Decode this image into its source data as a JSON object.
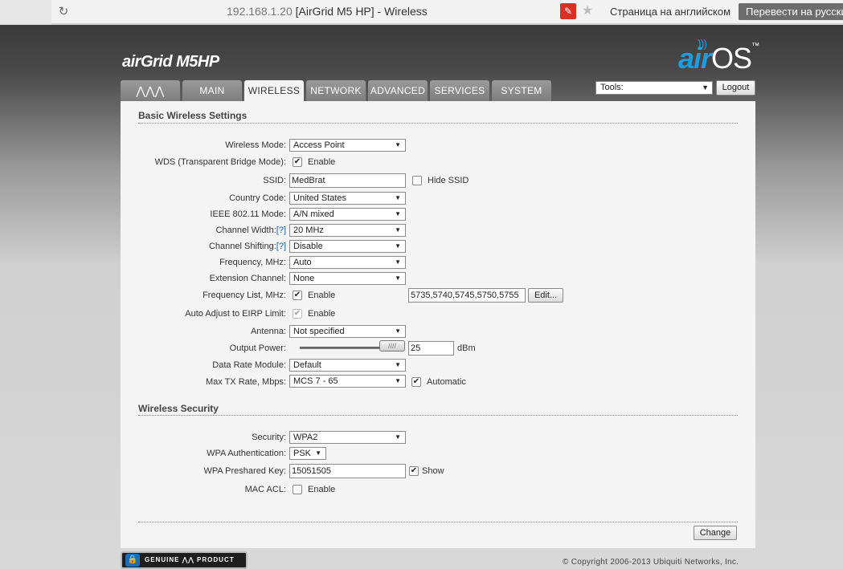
{
  "browser": {
    "url_host": "192.168.1.20",
    "page_title": "[AirGrid M5 HP] - Wireless",
    "translate_prompt": "Страница на английском",
    "translate_button": "Перевести на русский"
  },
  "brand": {
    "product": "airGrid M5HP",
    "os_logo_air": "air",
    "os_logo_os": "OS",
    "os_logo_tm": "™"
  },
  "tabs": [
    {
      "label": "",
      "icon": "ubiquiti-logo-icon"
    },
    {
      "label": "MAIN"
    },
    {
      "label": "WIRELESS",
      "active": true
    },
    {
      "label": "NETWORK"
    },
    {
      "label": "ADVANCED"
    },
    {
      "label": "SERVICES"
    },
    {
      "label": "SYSTEM"
    }
  ],
  "tools": {
    "label": "Tools:",
    "logout": "Logout"
  },
  "basic": {
    "title": "Basic Wireless Settings",
    "wireless_mode": {
      "label": "Wireless Mode:",
      "value": "Access Point"
    },
    "wds": {
      "label": "WDS (Transparent Bridge Mode):",
      "checked": true,
      "option": "Enable"
    },
    "ssid": {
      "label": "SSID:",
      "value": "MedBrat",
      "hide_label": "Hide SSID",
      "hide_checked": false
    },
    "country": {
      "label": "Country Code:",
      "value": "United States"
    },
    "ieee": {
      "label": "IEEE 802.11 Mode:",
      "value": "A/N mixed"
    },
    "channel_width": {
      "label": "Channel Width:",
      "help": "[?]",
      "value": "20 MHz"
    },
    "channel_shifting": {
      "label": "Channel Shifting:",
      "help": "[?]",
      "value": "Disable"
    },
    "frequency": {
      "label": "Frequency, MHz:",
      "value": "Auto"
    },
    "extension": {
      "label": "Extension Channel:",
      "value": "None"
    },
    "freq_list": {
      "label": "Frequency List, MHz:",
      "checked": true,
      "option": "Enable",
      "value": "5735,5740,5745,5750,5755",
      "edit": "Edit..."
    },
    "auto_adjust": {
      "label": "Auto Adjust to EIRP Limit:",
      "checked": true,
      "option": "Enable"
    },
    "antenna": {
      "label": "Antenna:",
      "value": "Not specified"
    },
    "output_power": {
      "label": "Output Power:",
      "value": "25",
      "unit": "dBm",
      "level": 1.0
    },
    "data_rate": {
      "label": "Data Rate Module:",
      "value": "Default"
    },
    "max_tx": {
      "label": "Max TX Rate, Mbps:",
      "value": "MCS 7 - 65",
      "auto_label": "Automatic",
      "auto_checked": true
    }
  },
  "security": {
    "title": "Wireless Security",
    "security": {
      "label": "Security:",
      "value": "WPA2"
    },
    "wpa_auth": {
      "label": "WPA Authentication:",
      "value": "PSK"
    },
    "psk": {
      "label": "WPA Preshared Key:",
      "value": "15051505",
      "show_label": "Show",
      "show_checked": true
    },
    "mac_acl": {
      "label": "MAC ACL:",
      "option": "Enable",
      "checked": false
    }
  },
  "change_button": "Change",
  "footer": {
    "genuine": "GENUINE",
    "product": "PRODUCT",
    "copyright": "© Copyright 2006-2013 Ubiquiti Networks, Inc."
  },
  "icons": {
    "check": "✔",
    "arrow": "▼"
  }
}
